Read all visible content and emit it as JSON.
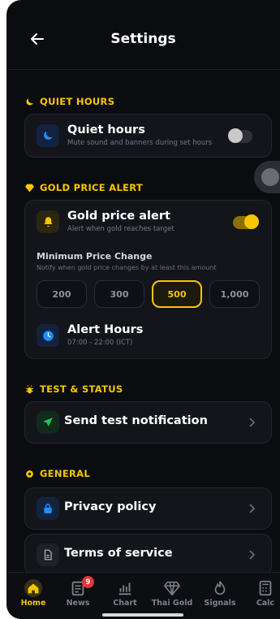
{
  "header": {
    "title": "Settings"
  },
  "quiet_hours": {
    "section_title": "QUIET HOURS",
    "label": "Quiet hours",
    "description": "Mute sound and banners during set hours",
    "enabled": false
  },
  "gold_alert": {
    "section_title": "GOLD PRICE ALERT",
    "label": "Gold price alert",
    "description": "Alert when gold reaches target",
    "enabled": true,
    "min_change_title": "Minimum Price Change",
    "min_change_description": "Notify when gold price changes by at least this amount",
    "options": [
      "200",
      "300",
      "500",
      "1,000"
    ],
    "selected_option": "500",
    "alert_hours_label": "Alert Hours",
    "alert_hours_value": "07:00 - 22:00 (ICT)"
  },
  "test_status": {
    "section_title": "TEST & STATUS",
    "send_test_label": "Send test notification"
  },
  "general": {
    "section_title": "GENERAL",
    "privacy_label": "Privacy policy",
    "terms_label": "Terms of service"
  },
  "tabs": [
    {
      "label": "Home",
      "icon": "home-icon",
      "active": true
    },
    {
      "label": "News",
      "icon": "news-icon",
      "badge": "9"
    },
    {
      "label": "Chart",
      "icon": "chart-icon"
    },
    {
      "label": "Thai Gold",
      "icon": "diamond-icon"
    },
    {
      "label": "Signals",
      "icon": "flame-icon"
    },
    {
      "label": "Calc",
      "icon": "calculator-icon"
    }
  ],
  "colors": {
    "accent": "#f7c600",
    "background": "#0b0c10",
    "card": "#13151b",
    "muted": "#757983",
    "blue": "#1e90ff",
    "green": "#22c55e",
    "badge": "#e5343a"
  }
}
